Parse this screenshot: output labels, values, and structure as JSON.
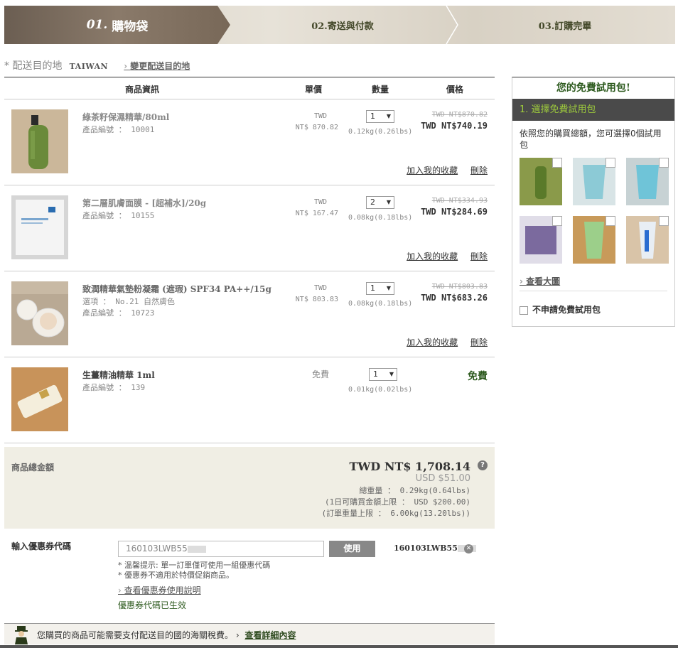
{
  "steps": [
    {
      "num": "01.",
      "label": "購物袋"
    },
    {
      "label": "02.寄送與付款"
    },
    {
      "label": "03.訂購完畢"
    }
  ],
  "destination": {
    "label": "* 配送目的地",
    "country": "TAIWAN",
    "change": "變更配送目的地"
  },
  "table": {
    "headers": [
      "商品資訊",
      "單價",
      "數量",
      "價格"
    ]
  },
  "items": [
    {
      "name": "綠茶籽保濕精華/80ml",
      "option": "",
      "code": "產品編號 ： 10001",
      "currency": "TWD",
      "unit_price": "NT$ 870.82",
      "qty": "1",
      "weight": "0.12kg(0.26lbs)",
      "old_price": "TWD NT$870.82",
      "price": "TWD NT$740.19",
      "wishlist": "加入我的收藏",
      "delete": "刪除"
    },
    {
      "name": "第二層肌膚面膜 - [超補水]/20g",
      "option": "",
      "code": "產品編號 ： 10155",
      "currency": "TWD",
      "unit_price": "NT$ 167.47",
      "qty": "2",
      "weight": "0.08kg(0.18lbs)",
      "old_price": "TWD NT$334.93",
      "price": "TWD NT$284.69",
      "wishlist": "加入我的收藏",
      "delete": "刪除"
    },
    {
      "name": "致潤精華氣墊粉凝霜 (遮瑕) SPF34 PA++/15g",
      "option": "選項 ： No.21 自然膚色",
      "code": "產品編號 ： 10723",
      "currency": "TWD",
      "unit_price": "NT$ 803.83",
      "qty": "1",
      "weight": "0.08kg(0.18lbs)",
      "old_price": "TWD NT$803.83",
      "price": "TWD NT$683.26",
      "wishlist": "加入我的收藏",
      "delete": "刪除"
    },
    {
      "name": "生薑精油精華 1ml",
      "option": "",
      "code": "產品編號 ： 139",
      "unit_free": "免費",
      "qty": "1",
      "weight": "0.01kg(0.02lbs)",
      "price_free": "免費"
    }
  ],
  "totals": {
    "label": "商品總金額",
    "total": "TWD NT$ 1,708.14",
    "help": "?",
    "usd": "USD $51.00",
    "weight": "總重量 ： 0.29kg(0.64lbs)",
    "daily_limit": "(1日可購買金額上限 ： USD $200.00)",
    "weight_limit": "(訂單重量上限 ： 6.00kg(13.20lbs))"
  },
  "coupon": {
    "label": "輸入優惠券代碼",
    "value": "160103LWB55",
    "button": "使用",
    "applied": "160103LWB55",
    "tip1": "* 溫馨提示: 單一訂單僅可使用一組優惠代碼",
    "tip2": "* 優惠券不適用於特價促銷商品。",
    "guide": "查看優惠券使用說明",
    "status": "優惠券代碼已生效"
  },
  "tax": {
    "text": "您購買的商品可能需要支付配送目的國的海關稅費。",
    "more": "查看詳細內容"
  },
  "sample": {
    "title": "您的免費試用包!",
    "step": "1. 選擇免費試用包",
    "desc": "依照您的購買總額，您可選擇0個試用包",
    "view_large": "查看大圖",
    "none": "不申請免費試用包"
  }
}
